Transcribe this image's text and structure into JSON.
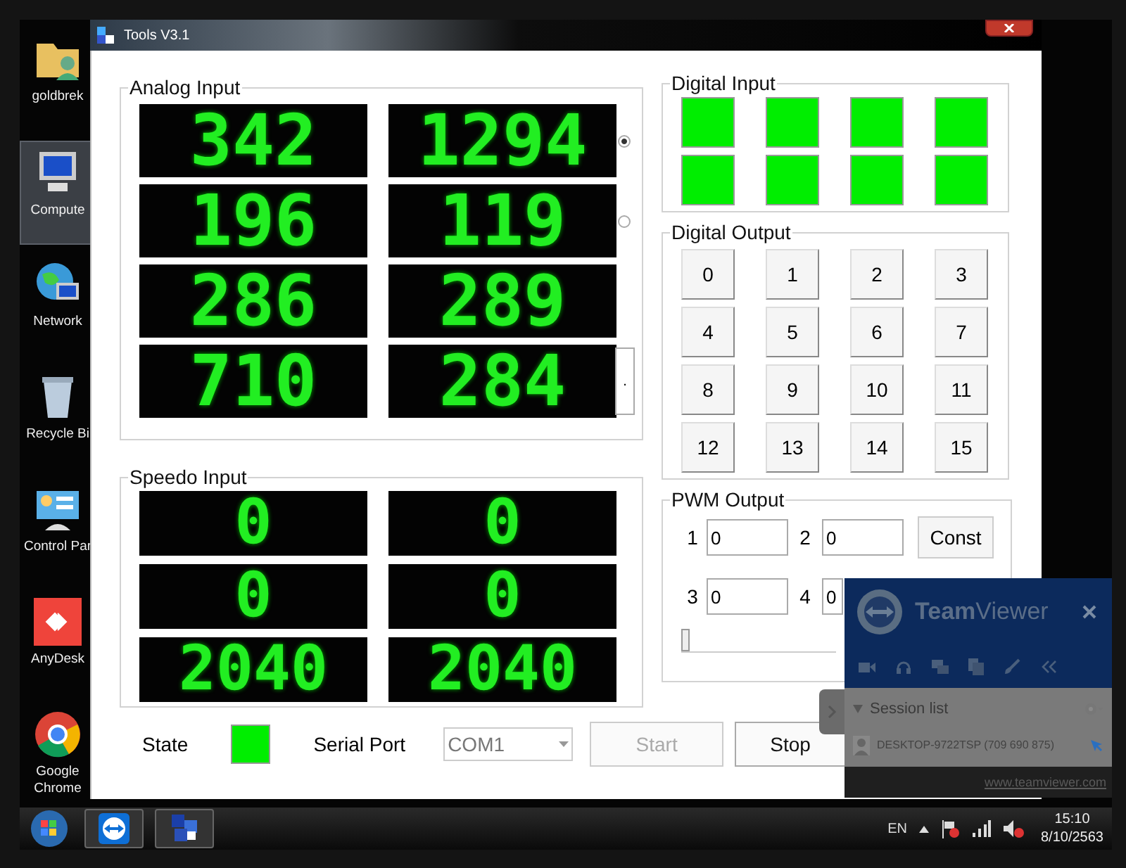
{
  "desktop_icons": [
    {
      "label": "goldbrek",
      "selected": false
    },
    {
      "label": "Compute",
      "selected": true
    },
    {
      "label": "Network",
      "selected": false
    },
    {
      "label": "Recycle Bi",
      "selected": false
    },
    {
      "label": "Control Par",
      "selected": false
    },
    {
      "label": "AnyDesk",
      "selected": false
    },
    {
      "label": "Google Chrome",
      "selected": false
    }
  ],
  "window": {
    "title": "Tools V3.1"
  },
  "analog_input": {
    "title": "Analog Input",
    "displays": [
      "342",
      "1294",
      "196",
      "119",
      "286",
      "289",
      "710",
      "284"
    ],
    "radios": [
      {
        "selected": true
      },
      {
        "selected": false
      }
    ],
    "side_button": "."
  },
  "speedo_input": {
    "title": "Speedo Input",
    "displays": [
      "0",
      "0",
      "0",
      "0",
      "2040",
      "2040"
    ]
  },
  "digital_input": {
    "title": "Digital Input",
    "lamps": [
      {
        "on": true
      },
      {
        "on": true
      },
      {
        "on": true
      },
      {
        "on": true
      },
      {
        "on": true
      },
      {
        "on": true
      },
      {
        "on": true
      },
      {
        "on": true
      }
    ]
  },
  "digital_output": {
    "title": "Digital Output",
    "buttons": [
      "0",
      "1",
      "2",
      "3",
      "4",
      "5",
      "6",
      "7",
      "8",
      "9",
      "10",
      "11",
      "12",
      "13",
      "14",
      "15"
    ]
  },
  "pwm_output": {
    "title": "PWM Output",
    "channels": [
      {
        "label": "1",
        "value": "0"
      },
      {
        "label": "2",
        "value": "0"
      },
      {
        "label": "3",
        "value": "0"
      },
      {
        "label": "4",
        "value": "0"
      }
    ],
    "const_button": "Const",
    "slider": {
      "level": 0
    }
  },
  "status": {
    "state_label": "State",
    "state_on": true,
    "serial_label": "Serial Port",
    "port": "COM1",
    "port_disabled": true,
    "start": {
      "label": "Start",
      "disabled": true
    },
    "stop": {
      "label": "Stop",
      "disabled": false
    }
  },
  "teamviewer": {
    "title": "**Team**Viewer",
    "session_list": "Session list",
    "session": "DESKTOP-9722TSP (709 690 875)",
    "link": "www.teamviewer.com"
  },
  "taskbar": {
    "language": "EN",
    "time": "15:10",
    "date": "8/10/2563"
  }
}
